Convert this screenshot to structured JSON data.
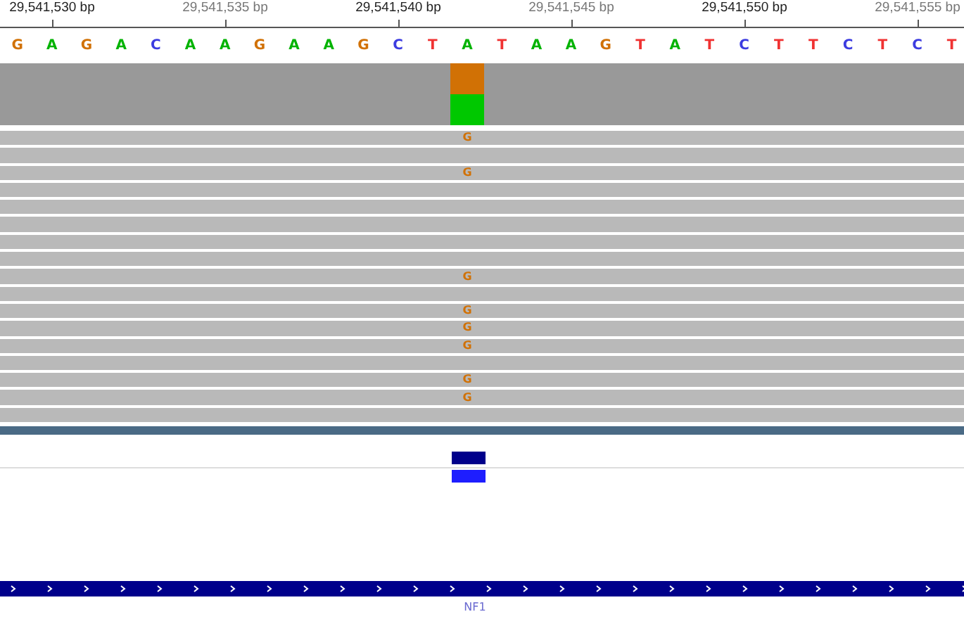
{
  "ruler": {
    "ticks": [
      {
        "label": "29,541,530 bp",
        "major": true
      },
      {
        "label": "29,541,535 bp",
        "major": false
      },
      {
        "label": "29,541,540 bp",
        "major": true
      },
      {
        "label": "29,541,545 bp",
        "major": false
      },
      {
        "label": "29,541,550 bp",
        "major": true
      },
      {
        "label": "29,541,555 bp",
        "major": false
      }
    ]
  },
  "reference": [
    {
      "base": "G",
      "color": "#d17105"
    },
    {
      "base": "A",
      "color": "#00b300"
    },
    {
      "base": "G",
      "color": "#d17105"
    },
    {
      "base": "A",
      "color": "#00b300"
    },
    {
      "base": "C",
      "color": "#3c3ce0"
    },
    {
      "base": "A",
      "color": "#00b300"
    },
    {
      "base": "A",
      "color": "#00b300"
    },
    {
      "base": "G",
      "color": "#d17105"
    },
    {
      "base": "A",
      "color": "#00b300"
    },
    {
      "base": "A",
      "color": "#00b300"
    },
    {
      "base": "G",
      "color": "#d17105"
    },
    {
      "base": "C",
      "color": "#3c3ce0"
    },
    {
      "base": "T",
      "color": "#f03232"
    },
    {
      "base": "A",
      "color": "#00b300"
    },
    {
      "base": "T",
      "color": "#f03232"
    },
    {
      "base": "A",
      "color": "#00b300"
    },
    {
      "base": "A",
      "color": "#00b300"
    },
    {
      "base": "G",
      "color": "#d17105"
    },
    {
      "base": "T",
      "color": "#f03232"
    },
    {
      "base": "A",
      "color": "#00b300"
    },
    {
      "base": "T",
      "color": "#f03232"
    },
    {
      "base": "C",
      "color": "#3c3ce0"
    },
    {
      "base": "T",
      "color": "#f03232"
    },
    {
      "base": "T",
      "color": "#f03232"
    },
    {
      "base": "C",
      "color": "#3c3ce0"
    },
    {
      "base": "T",
      "color": "#f03232"
    },
    {
      "base": "C",
      "color": "#3c3ce0"
    },
    {
      "base": "T",
      "color": "#f03232"
    }
  ],
  "coverage": [
    {
      "kind": "plain"
    },
    {
      "kind": "plain"
    },
    {
      "kind": "plain"
    },
    {
      "kind": "plain"
    },
    {
      "kind": "plain"
    },
    {
      "kind": "plain"
    },
    {
      "kind": "plain"
    },
    {
      "kind": "plain"
    },
    {
      "kind": "plain"
    },
    {
      "kind": "plain"
    },
    {
      "kind": "plain"
    },
    {
      "kind": "plain"
    },
    {
      "kind": "plain"
    },
    {
      "kind": "mismatch",
      "alleles": [
        {
          "color": "#d17105",
          "level": 0.5
        },
        {
          "color": "#00c800",
          "level": 0.5
        }
      ]
    },
    {
      "kind": "plain"
    },
    {
      "kind": "plain"
    },
    {
      "kind": "plain"
    },
    {
      "kind": "plain"
    },
    {
      "kind": "plain"
    },
    {
      "kind": "plain"
    },
    {
      "kind": "plain"
    },
    {
      "kind": "plain"
    },
    {
      "kind": "plain"
    },
    {
      "kind": "plain"
    },
    {
      "kind": "plain"
    },
    {
      "kind": "plain"
    },
    {
      "kind": "plain"
    },
    {
      "kind": "plain"
    }
  ],
  "reads": [
    {
      "kind": "mismatch",
      "base": "G"
    },
    {
      "kind": "match"
    },
    {
      "kind": "mismatch",
      "base": "G"
    },
    {
      "kind": "match"
    },
    {
      "kind": "match"
    },
    {
      "kind": "match"
    },
    {
      "kind": "match"
    },
    {
      "kind": "match"
    },
    {
      "kind": "mismatch",
      "base": "G"
    },
    {
      "kind": "match"
    },
    {
      "kind": "mismatch",
      "base": "G"
    },
    {
      "kind": "mismatch",
      "base": "G"
    },
    {
      "kind": "mismatch",
      "base": "G"
    },
    {
      "kind": "match"
    },
    {
      "kind": "mismatch",
      "base": "G"
    },
    {
      "kind": "mismatch",
      "base": "G"
    },
    {
      "kind": "match"
    }
  ],
  "variants": [
    {
      "color": "#00008b"
    },
    {
      "color": "#1e1eff"
    }
  ],
  "gene": {
    "name": "NF1"
  }
}
